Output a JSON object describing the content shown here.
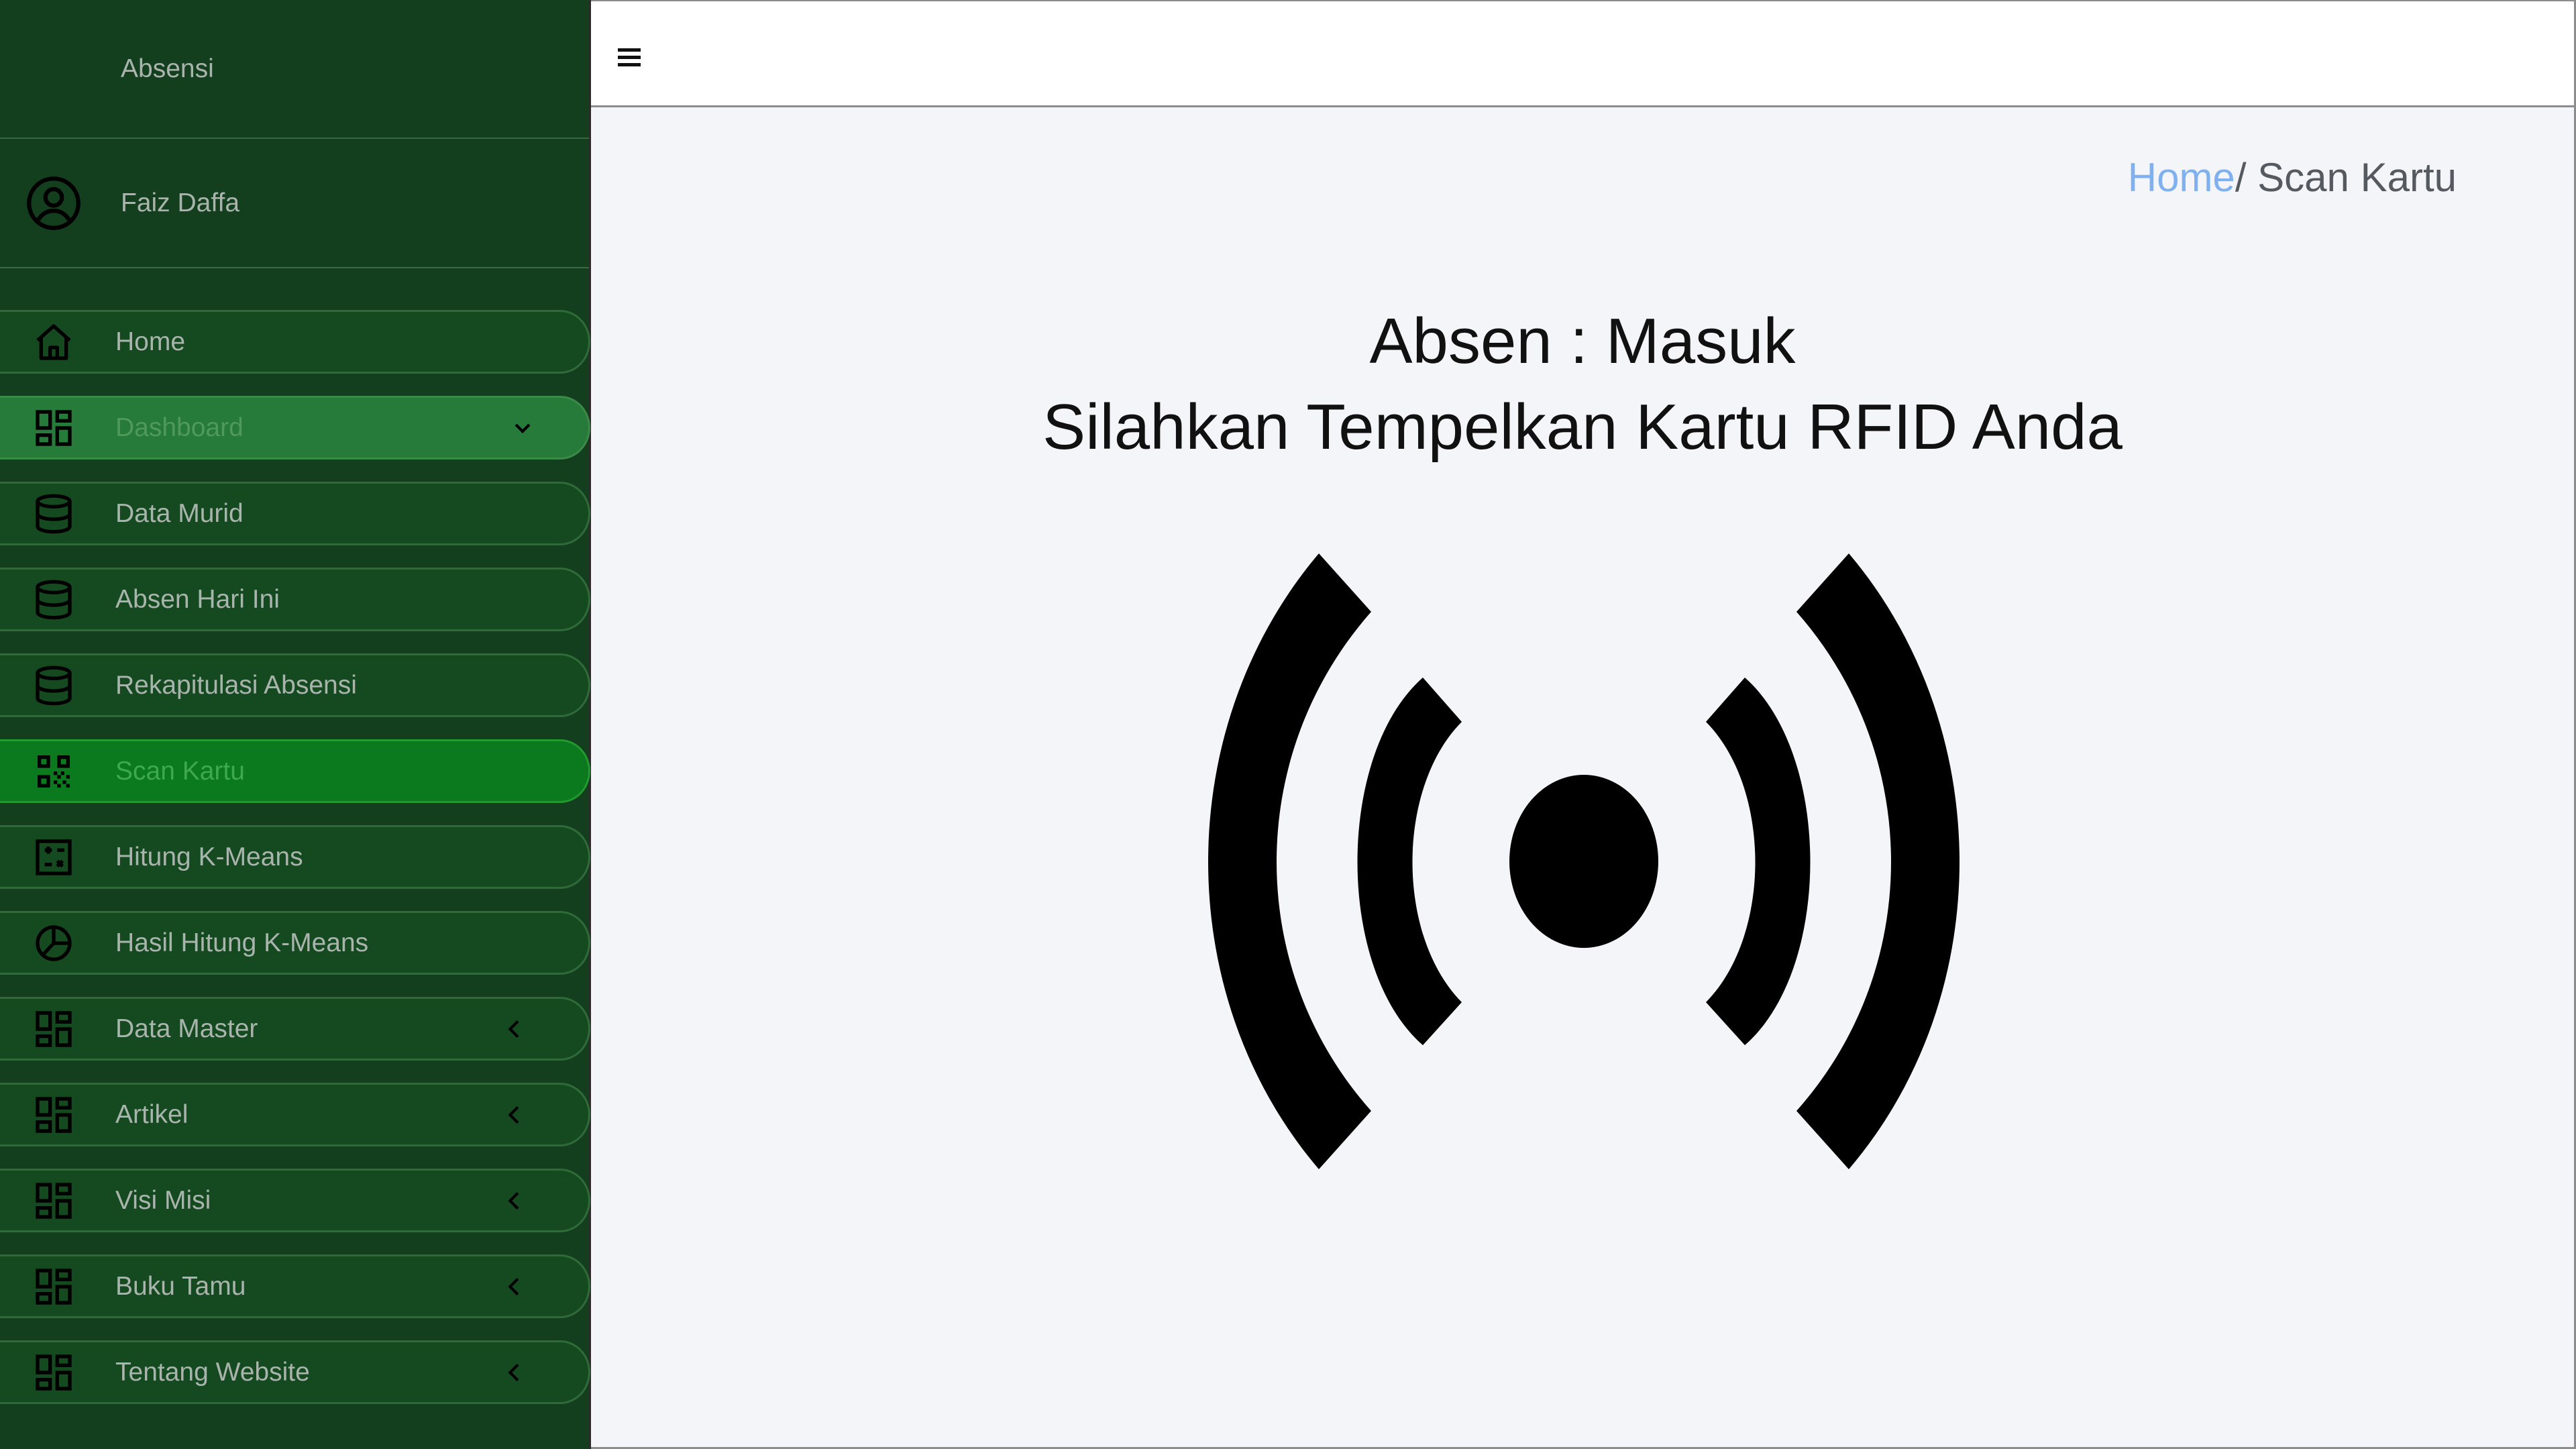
{
  "sidebar": {
    "brand": "Absensi",
    "user_name": "Faiz Daffa",
    "items": [
      {
        "label": "Home",
        "icon": "home-icon"
      },
      {
        "label": "Dashboard",
        "icon": "grid-icon"
      },
      {
        "label": "Data Murid",
        "icon": "database-icon"
      },
      {
        "label": "Absen Hari Ini",
        "icon": "database-icon"
      },
      {
        "label": "Rekapitulasi Absensi",
        "icon": "database-icon"
      },
      {
        "label": "Scan Kartu",
        "icon": "qr-icon"
      },
      {
        "label": "Hitung K-Means",
        "icon": "calculator-icon"
      },
      {
        "label": "Hasil Hitung K-Means",
        "icon": "pie-icon"
      },
      {
        "label": "Data Master",
        "icon": "grid-icon"
      },
      {
        "label": "Artikel",
        "icon": "grid-icon"
      },
      {
        "label": "Visi Misi",
        "icon": "grid-icon"
      },
      {
        "label": "Buku Tamu",
        "icon": "grid-icon"
      },
      {
        "label": "Tentang Website",
        "icon": "grid-icon"
      }
    ]
  },
  "breadcrumb": {
    "home": "Home",
    "current": "/ Scan Kartu"
  },
  "main": {
    "title_line1": "Absen : Masuk",
    "title_line2": "Silahkan Tempelkan Kartu RFID Anda"
  },
  "colors": {
    "sidebar_bg": "#133f1e",
    "active_item": "#0b7a1f",
    "dashboard_item": "#267a3a",
    "breadcrumb_link": "#7fb0f0",
    "content_bg": "#f4f5f9"
  }
}
